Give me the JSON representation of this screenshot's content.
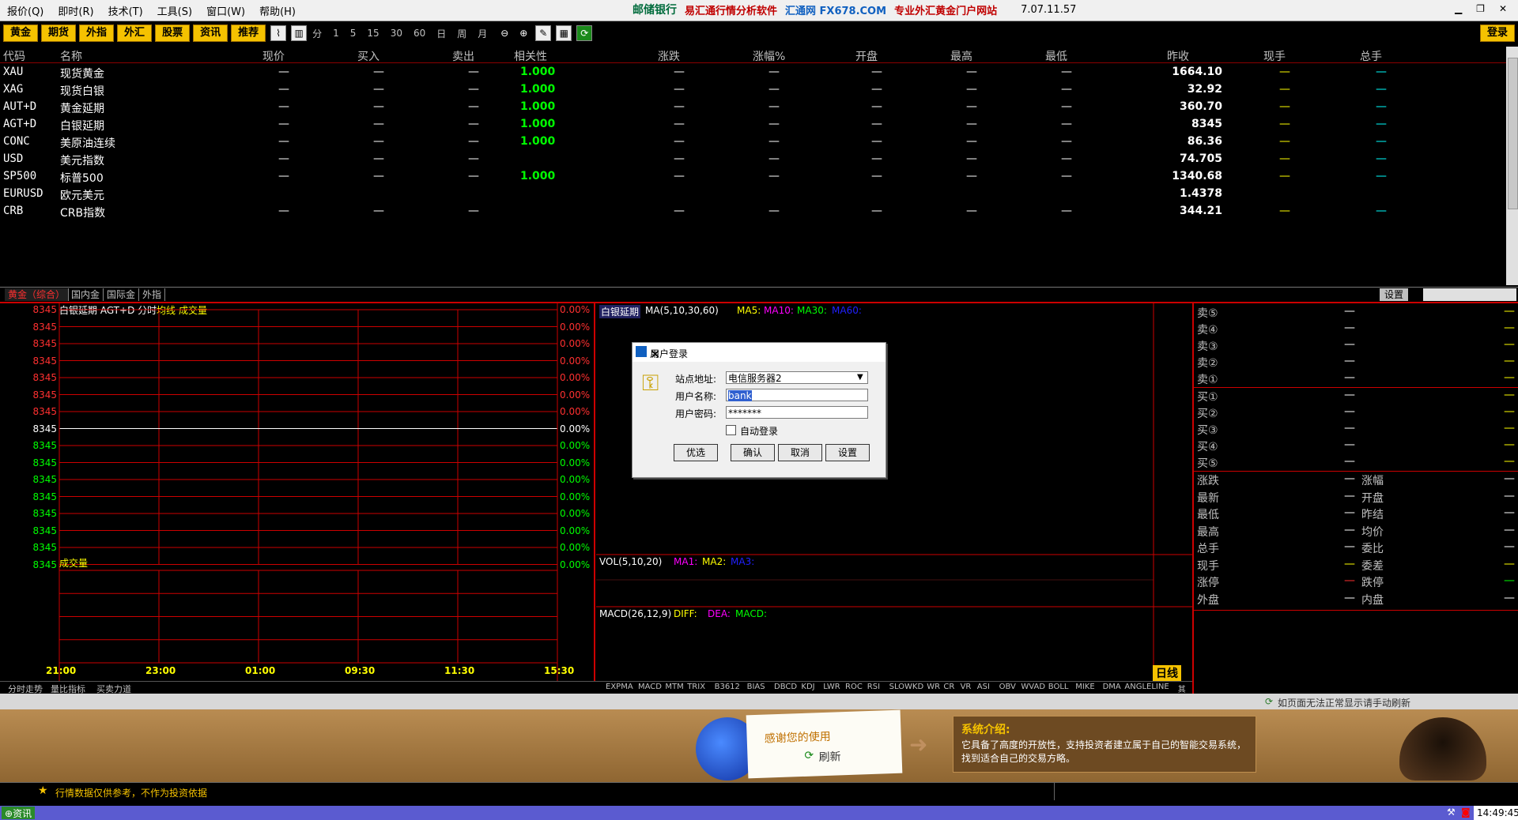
{
  "menu": [
    "报价(Q)",
    "即时(R)",
    "技术(T)",
    "工具(S)",
    "窗口(W)",
    "帮助(H)"
  ],
  "brand": {
    "bank": "邮储银行",
    "software": "易汇通行情分析软件",
    "site": "汇通网 FX678.COM",
    "slogan": "专业外汇黄金门户网站",
    "version": "7.07.11.57"
  },
  "toolbar": {
    "buttons": [
      "黄金",
      "期货",
      "外指",
      "外汇",
      "股票",
      "资讯",
      "推荐"
    ],
    "periods": [
      "分",
      "1",
      "5",
      "15",
      "30",
      "60",
      "日",
      "周",
      "月"
    ],
    "login": "登录"
  },
  "quote_table": {
    "headers": [
      "代码",
      "名称",
      "现价",
      "买入",
      "卖出",
      "相关性",
      "涨跌",
      "涨幅%",
      "开盘",
      "最高",
      "最低",
      "昨收",
      "现手",
      "总手"
    ],
    "rows": [
      {
        "code": "XAU",
        "name": "现货黄金",
        "corr": "1.000",
        "prev": "1664.10"
      },
      {
        "code": "XAG",
        "name": "现货白银",
        "corr": "1.000",
        "prev": "32.92"
      },
      {
        "code": "AUT+D",
        "name": "黄金延期",
        "corr": "1.000",
        "prev": "360.70"
      },
      {
        "code": "AGT+D",
        "name": "白银延期",
        "corr": "1.000",
        "prev": "8345"
      },
      {
        "code": "CONC",
        "name": "美原油连续",
        "corr": "1.000",
        "prev": "86.36"
      },
      {
        "code": "USD",
        "name": "美元指数",
        "corr": "",
        "prev": "74.705"
      },
      {
        "code": "SP500",
        "name": "标普500",
        "corr": "1.000",
        "prev": "1340.68"
      },
      {
        "code": "EURUSD",
        "name": "欧元美元",
        "corr": "",
        "prev": "1.4378"
      },
      {
        "code": "CRB",
        "name": "CRB指数",
        "corr": "",
        "prev": "344.21"
      }
    ],
    "dash": "—"
  },
  "tabs": [
    "黄金（综合）",
    "国内金",
    "国际金",
    "外指"
  ],
  "tab_settings": "设置",
  "intraday": {
    "title": "白银延期 AGT+D 分时",
    "avg_label": "均线",
    "vol_label": "成交量",
    "price_value": "8345",
    "pct_value": "0.00%",
    "vol_title": "成交量",
    "times": [
      "21:00",
      "23:00",
      "01:00",
      "09:30",
      "11:30",
      "15:30"
    ],
    "bottom_links": [
      "分时走势",
      "量比指标",
      "买卖力道"
    ]
  },
  "kline": {
    "title": "白银延期",
    "ma": "MA(5,10,30,60)",
    "ma5": "MA5:",
    "ma10": "MA10:",
    "ma30": "MA30:",
    "ma60": "MA60:",
    "vol": "VOL(5,10,20)",
    "vma1": "MA1:",
    "vma2": "MA2:",
    "vma3": "MA3:",
    "macd": "MACD(26,12,9)",
    "diff": "DIFF:",
    "dea": "DEA:",
    "macdv": "MACD:",
    "period_badge": "日线",
    "indicators": [
      "EXPMA",
      "MACD",
      "MTM",
      "TRIX",
      "B3612",
      "BIAS",
      "DBCD",
      "KDJ",
      "LWR",
      "ROC",
      "RSI",
      "SLOWKD",
      "WR",
      "CR",
      "VR",
      "ASI",
      "OBV",
      "WVAD",
      "BOLL",
      "MIKE",
      "DMA",
      "ANGLELINE",
      "其他指标"
    ]
  },
  "side": {
    "sell": [
      "卖⑤",
      "卖④",
      "卖③",
      "卖②",
      "卖①"
    ],
    "buy": [
      "买①",
      "买②",
      "买③",
      "买④",
      "买⑤"
    ],
    "stats_left": [
      "涨跌",
      "最新",
      "最低",
      "最高",
      "总手",
      "现手",
      "涨停",
      "外盘"
    ],
    "stats_right": [
      "涨幅",
      "开盘",
      "昨结",
      "均价",
      "委比",
      "委差",
      "跌停",
      "内盘"
    ]
  },
  "login_dialog": {
    "title": "用户登录",
    "site_label": "站点地址:",
    "site_value": "电信服务器2",
    "user_label": "用户名称:",
    "user_value": "bank",
    "pwd_label": "用户密码:",
    "pwd_value": "*******",
    "auto_login": "自动登录",
    "buttons": [
      "优选",
      "确认",
      "取消",
      "设置"
    ]
  },
  "banner": {
    "refresh_notice": "如页面无法正常显示请手动刷新",
    "thanks": "感谢您的使用",
    "refresh": "刷新",
    "intro_title": "系统介绍:",
    "intro_text": "它具备了高度的开放性，支持投资者建立属于自己的智能交易系统，找到适合自己的交易方略。"
  },
  "status": {
    "disclaimer": "行情数据仅供参考，不作为投资依据",
    "news": "资讯",
    "clock": "14:49:45"
  },
  "colors": {
    "accent_yellow": "#f5c200",
    "grid_red": "#cc0000",
    "green": "#00ff00"
  }
}
